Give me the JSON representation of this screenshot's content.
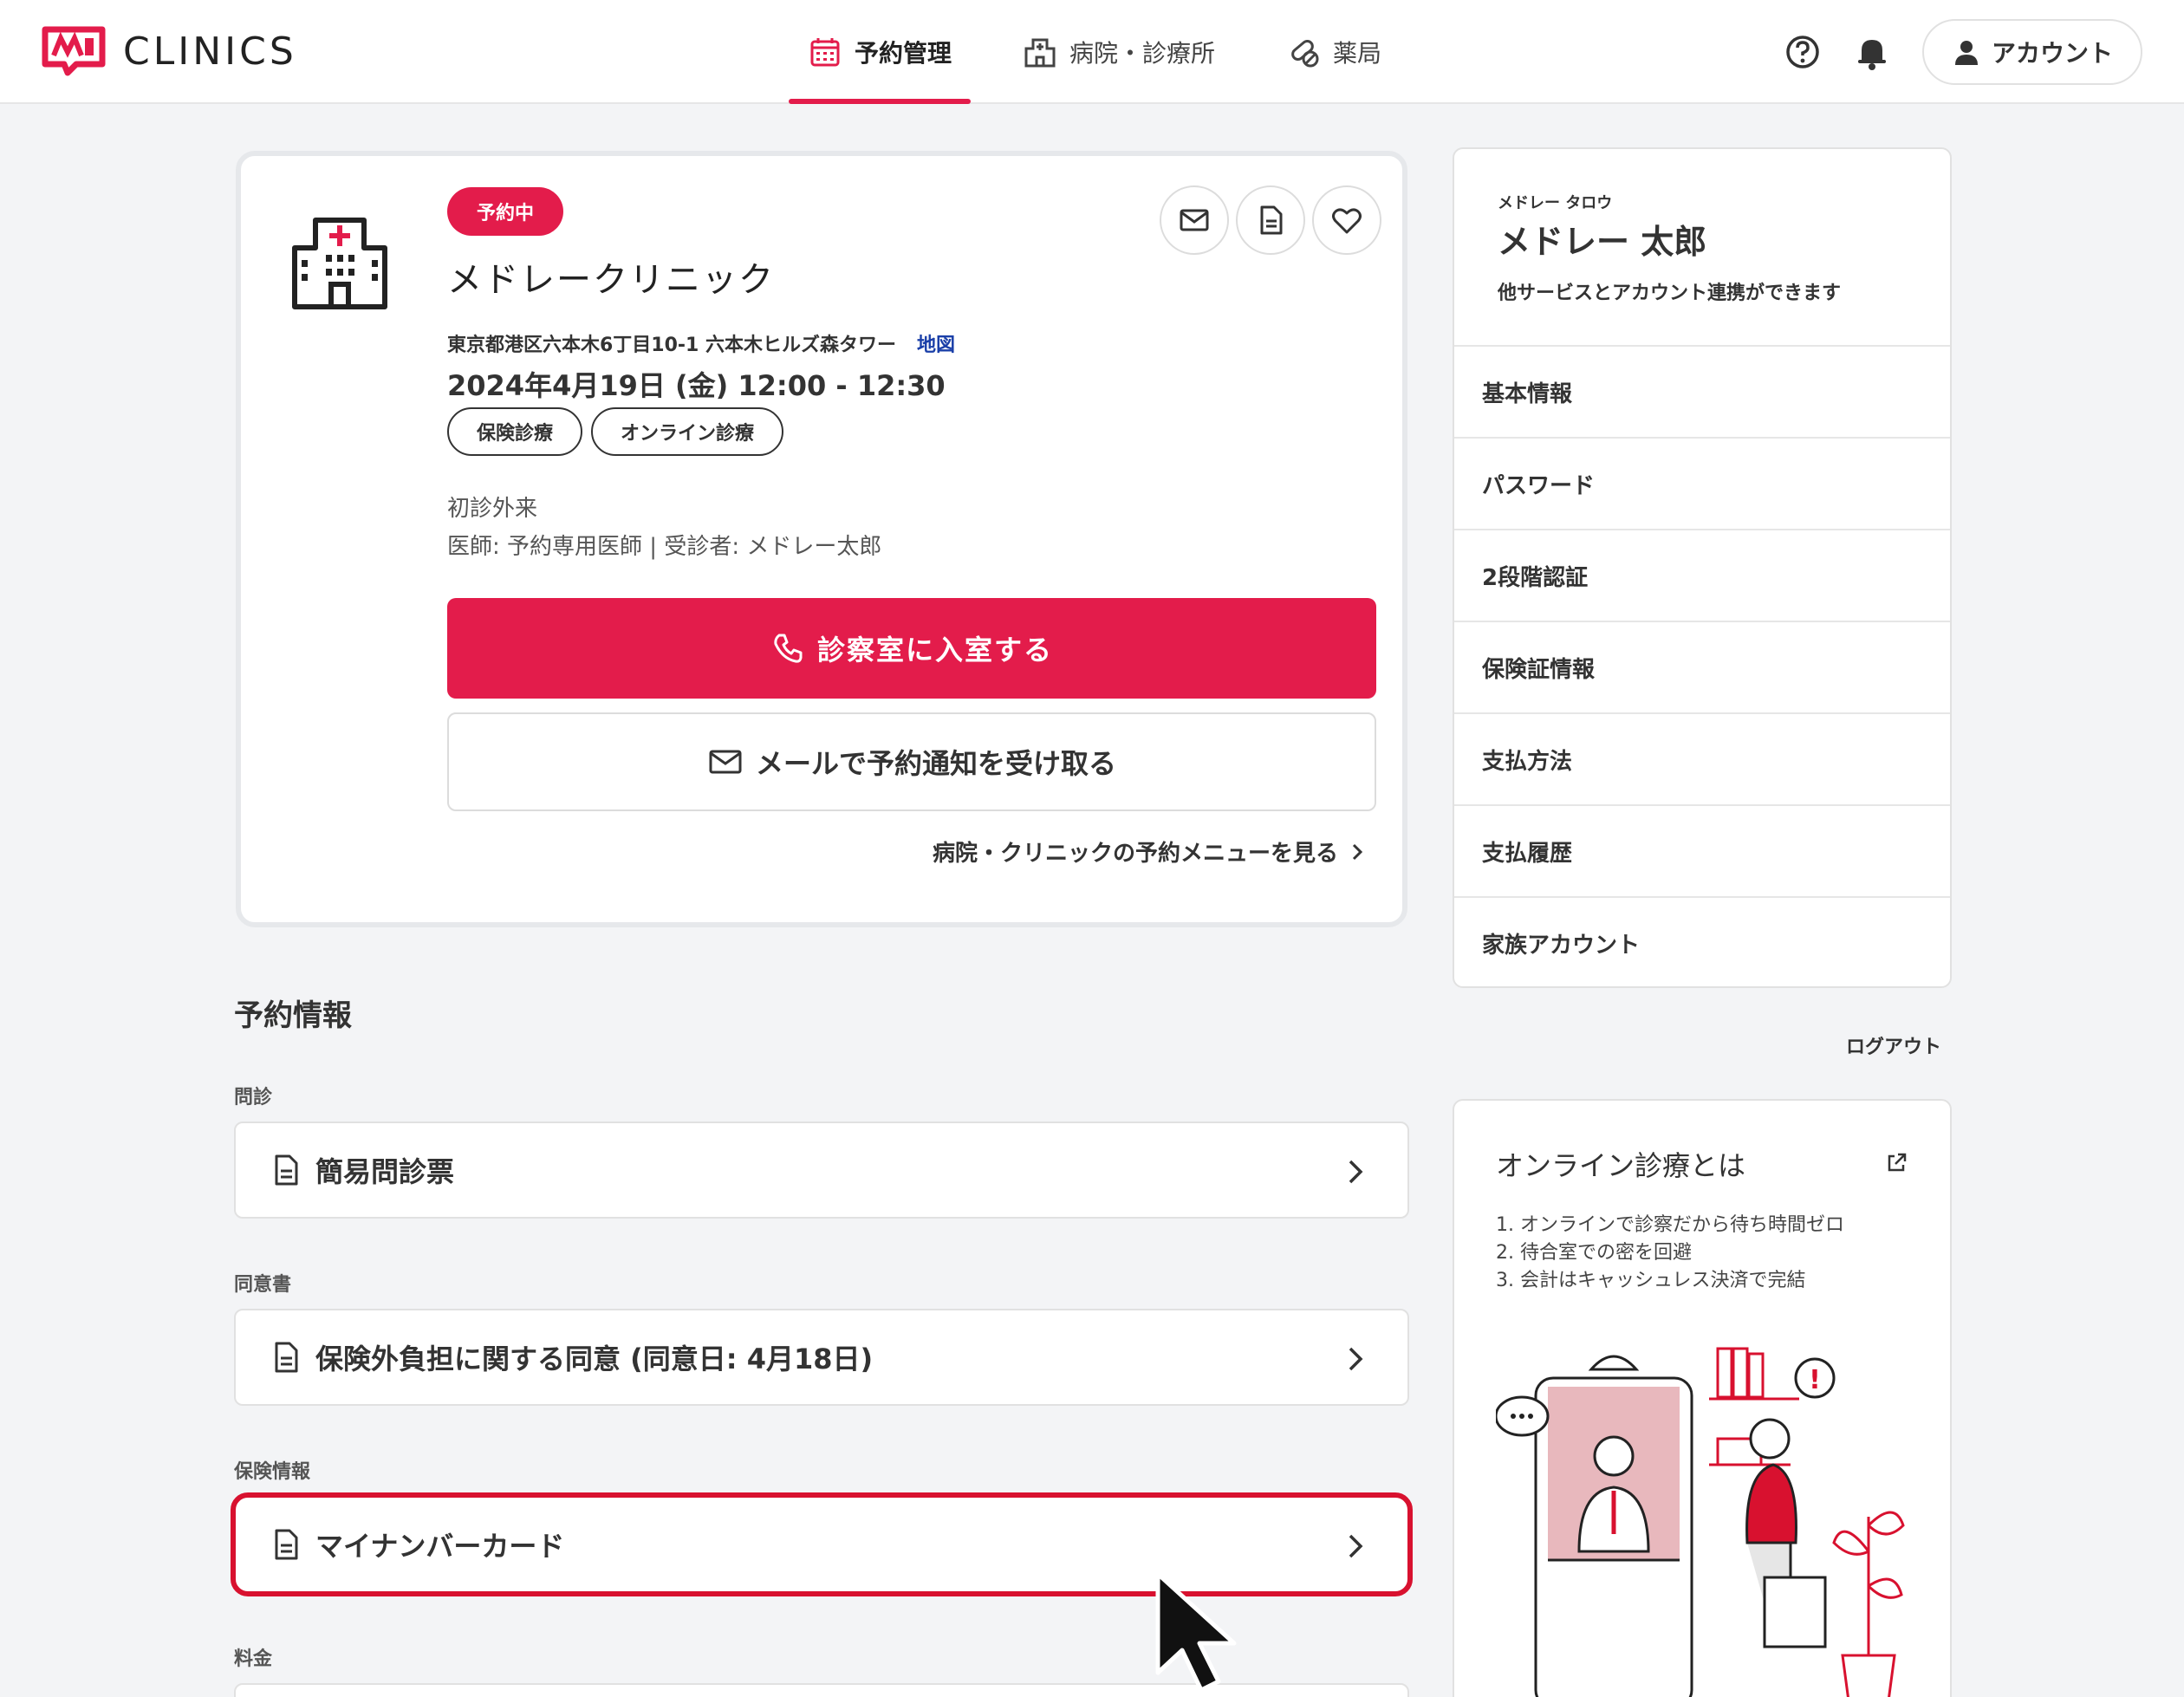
{
  "brand": {
    "name": "CLINICS"
  },
  "nav": {
    "items": [
      {
        "label": "予約管理",
        "icon": "calendar-icon",
        "active": true
      },
      {
        "label": "病院・診療所",
        "icon": "hospital-icon",
        "active": false
      },
      {
        "label": "薬局",
        "icon": "pill-icon",
        "active": false
      }
    ]
  },
  "header": {
    "account_label": "アカウント"
  },
  "reservation": {
    "status": "予約中",
    "clinic_name": "メドレークリニック",
    "address": "東京都港区六本木6丁目10-1 六本木ヒルズ森タワー",
    "map_label": "地図",
    "datetime": "2024年4月19日 (金) 12:00 - 12:30",
    "tags": [
      "保険診療",
      "オンライン診療"
    ],
    "visit_type": "初診外来",
    "doctor_info": "医師: 予約専用医師 | 受診者: メドレー太郎",
    "enter_button": "診察室に入室する",
    "mail_button": "メールで予約通知を受け取る",
    "menu_link": "病院・クリニックの予約メニューを見る"
  },
  "info": {
    "title": "予約情報",
    "groups": [
      {
        "label": "問診",
        "item": "簡易問診票"
      },
      {
        "label": "同意書",
        "item": "保険外負担に関する同意 (同意日: 4月18日)"
      },
      {
        "label": "保険情報",
        "item": "マイナンバーカード"
      },
      {
        "label": "料金",
        "item": ""
      }
    ]
  },
  "profile": {
    "kana": "メドレー タロウ",
    "name": "メドレー 太郎",
    "note": "他サービスとアカウント連携ができます",
    "menu": [
      "基本情報",
      "パスワード",
      "2段階認証",
      "保険証情報",
      "支払方法",
      "支払履歴",
      "家族アカウント"
    ],
    "logout": "ログアウト"
  },
  "promo": {
    "title": "オンライン診療とは",
    "points": [
      "1. オンラインで診察だから待ち時間ゼロ",
      "2. 待合室での密を回避",
      "3. 会計はキャッシュレス決済で完結"
    ]
  },
  "colors": {
    "accent": "#e31c4b",
    "highlight": "#d8112f",
    "link": "#1a3fa8"
  }
}
